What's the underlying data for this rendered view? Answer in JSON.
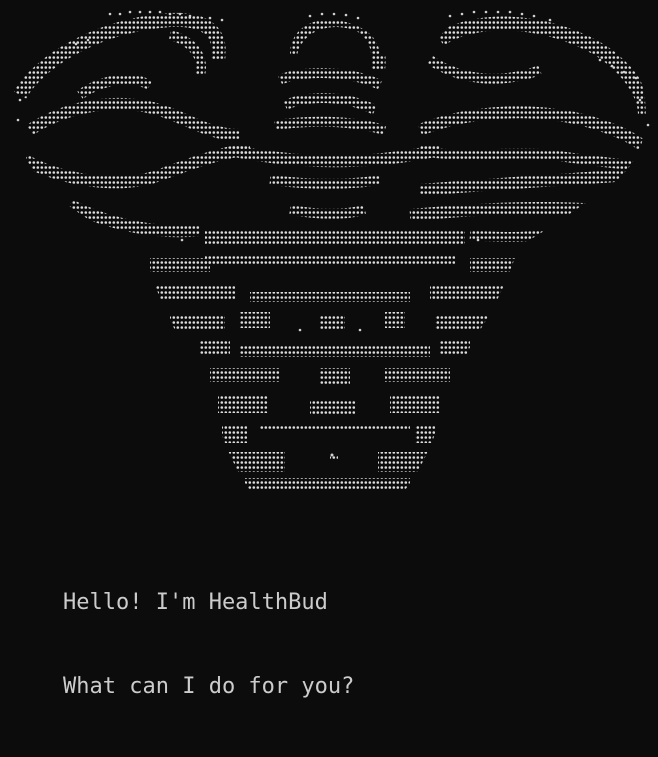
{
  "terminal": {
    "background": "#0c0c0c",
    "foreground": "#cccccc",
    "ascii_art_icon": "braille-heart-mascot-art",
    "greeting_lines": [
      "Hello! I'm HealthBud",
      "What can I do for you?"
    ]
  }
}
